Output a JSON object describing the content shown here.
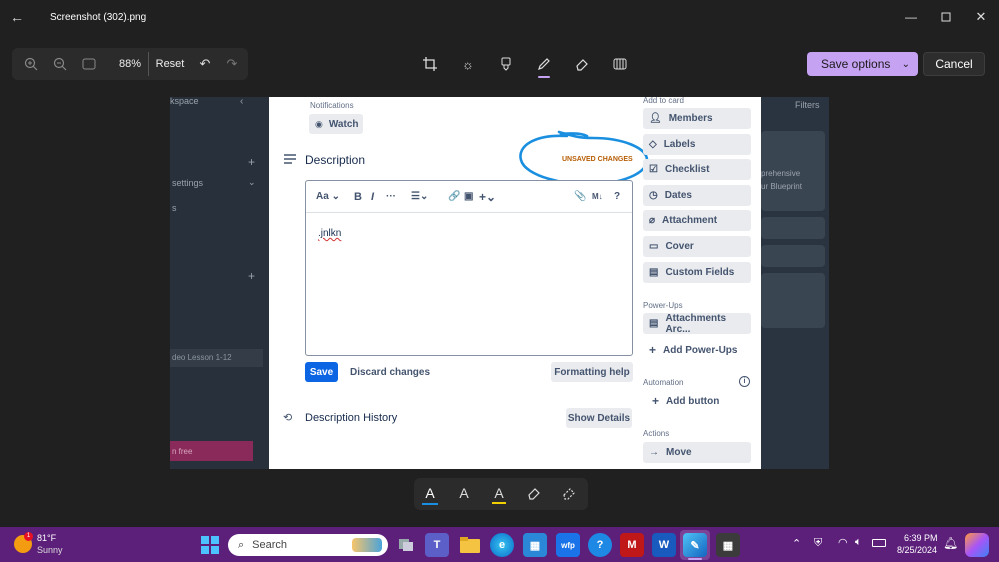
{
  "titlebar": {
    "title": "Screenshot (302).png",
    "back_icon": "arrow-left-icon",
    "min_icon": "minimize-icon",
    "max_icon": "maximize-icon",
    "close_icon": "close-icon"
  },
  "toolbar": {
    "zoom": "88%",
    "reset_label": "Reset",
    "save_options_label": "Save options",
    "cancel_label": "Cancel"
  },
  "background": {
    "left_texts": [
      "kspace",
      "settings",
      "s",
      "deo Lesson 1-12",
      "n free"
    ],
    "right_texts": [
      "Filters",
      "prehensive",
      "ur Blueprint"
    ]
  },
  "card": {
    "notifications_label": "Notifications",
    "watch_label": "Watch",
    "description_label": "Description",
    "unsaved_label": "UNSAVED CHANGES",
    "editor_text": ".jnlkn",
    "editor_toolbar": {
      "text_style": "Aa",
      "bold": "B",
      "italic": "I",
      "more": "···",
      "markdown": "M↓",
      "help": "?"
    },
    "save_label": "Save",
    "discard_label": "Discard changes",
    "formatting_help_label": "Formatting help",
    "history_label": "Description History",
    "show_details_label": "Show Details",
    "sidebar": {
      "add_to_card": "Add to card",
      "items": [
        "Members",
        "Labels",
        "Checklist",
        "Dates",
        "Attachment",
        "Cover",
        "Custom Fields"
      ],
      "powerups_head": "Power-Ups",
      "attachments_arc": "Attachments Arc...",
      "add_powerups": "Add Power-Ups",
      "automation_head": "Automation",
      "add_button": "Add button",
      "actions_head": "Actions",
      "move": "Move"
    },
    "annotation_color": "#1a8fe0"
  },
  "taskbar": {
    "weather_temp": "81°F",
    "weather_desc": "Sunny",
    "search_placeholder": "Search",
    "time": "6:39 PM",
    "date": "8/25/2024",
    "accent": "#5c1f7a"
  }
}
